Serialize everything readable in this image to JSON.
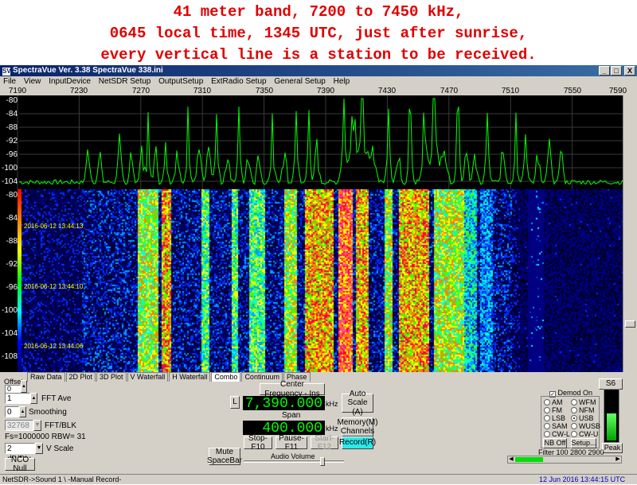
{
  "caption": {
    "line1": "41 meter band, 7200 to 7450 kHz,",
    "line2": "0645 local time, 1345 UTC, just after sunrise,",
    "line3": "every vertical line is a station to be received."
  },
  "window": {
    "title": "SpectraVue Ver. 3.38  SpectraVue 338.ini",
    "icon": "SV",
    "minimize": "_",
    "maximize": "□",
    "close": "X"
  },
  "menu": [
    "File",
    "View",
    "InputDevice",
    "NetSDR Setup",
    "OutputSetup",
    "ExtRadio Setup",
    "General Setup",
    "Help"
  ],
  "freq_ticks": [
    "7190",
    "7230",
    "7270",
    "7310",
    "7350",
    "7390",
    "7430",
    "7470",
    "7510",
    "7550",
    "7590"
  ],
  "spectrum_db_labels": [
    "-80",
    "-84",
    "-88",
    "-92",
    "-96",
    "-100",
    "-104"
  ],
  "waterfall_db_labels": [
    "-80",
    "-84",
    "-88",
    "-92",
    "-96",
    "-100",
    "-104",
    "-108"
  ],
  "waterfall_timestamps": [
    "2016-06-12 13:44:13",
    "2016-06-12 13:44:10",
    "2016-06-12 13:44:06"
  ],
  "tabs": [
    "Raw Data",
    "2D Plot",
    "3D Plot",
    "V Waterfall",
    "H Waterfall",
    "Combo",
    "Continuum",
    "Phase"
  ],
  "active_tab": "Combo",
  "controls": {
    "offset_label": "Offset",
    "offset_value": "0",
    "fft_ave_value": "1",
    "fft_ave_label": "FFT Ave",
    "smoothing_value": "0",
    "smoothing_label": "Smoothing",
    "fft_blk_value": "32768",
    "fft_blk_label": "FFT/BLK",
    "fs_text": "Fs=1000000 RBW= 31",
    "vscale_value": "2 dB/Div",
    "vscale_label": "V Scale",
    "nco_null": "NCO Null",
    "center_freq_button": "Center Frequency - Ins",
    "l_button": "L",
    "center_freq": "7,390.000",
    "freq_unit": "kHz",
    "span_label": "Span",
    "span_value": "400.000",
    "span_unit": "kHz",
    "auto_scale": "Auto Scale (A)",
    "memory_channels": "Memory(M) Channels",
    "stop": "Stop-F10",
    "pause": "Pause-F11",
    "start": "Start-F12",
    "record": "Record(R)",
    "mute": "Mute SpaceBar",
    "audio_volume_label": "Audio Volume",
    "audio_volume_level": 0.8
  },
  "demod": {
    "smeter_label": "S6",
    "demod_on_label": "Demod On",
    "demod_on_checked": true,
    "modes": [
      "AM",
      "WFM",
      "FM",
      "NFM",
      "LSB",
      "USB",
      "SAM",
      "WUSB",
      "CW-L",
      "CW-U"
    ],
    "selected": "USB",
    "nb_off": "NB Off",
    "setup": "Setup...",
    "peak": "Peak",
    "filter_text": "Filter 100   2800   2900",
    "level_fraction": 0.55
  },
  "status": {
    "left": "NetSDR->Sound 1  \\ -Manual Record-",
    "datetime": "12 Jun 2016  13:44:15 UTC"
  },
  "colors": {
    "caption": "#e00000",
    "lcd_text": "#00ff00",
    "spectrum_trace": "#00ff00",
    "record_button": "#2ee8e8"
  }
}
